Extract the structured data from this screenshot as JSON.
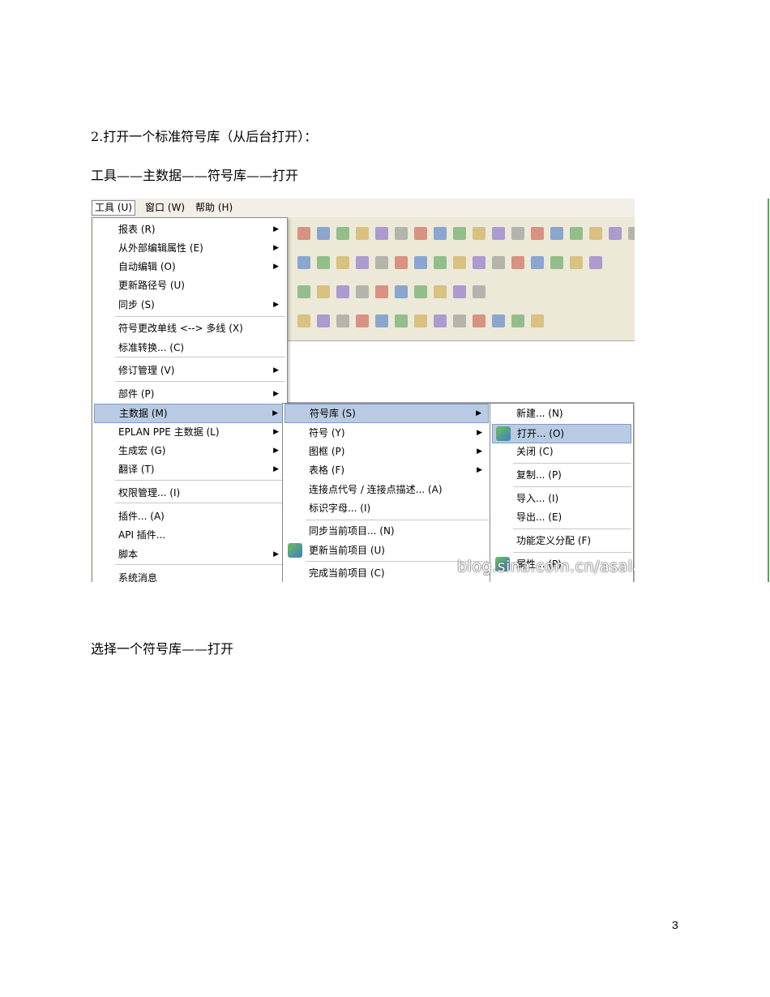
{
  "document": {
    "heading": "2.打开一个标准符号库（从后台打开）：",
    "path": "工具——主数据——符号库——打开",
    "caption": "选择一个符号库——打开",
    "page_number": "3"
  },
  "screenshot": {
    "menubar": [
      "工具 (U)",
      "窗口 (W)",
      "帮助 (H)"
    ],
    "tools_menu": [
      {
        "label": "报表 (R)",
        "submenu": true
      },
      {
        "label": "从外部编辑属性 (E)",
        "submenu": true
      },
      {
        "label": "自动编辑 (O)",
        "submenu": true
      },
      {
        "label": "更新路径号 (U)",
        "submenu": false
      },
      {
        "label": "同步 (S)",
        "submenu": true
      },
      {
        "label": "符号更改单线 <--> 多线 (X)",
        "submenu": false
      },
      {
        "label": "标准转换... (C)",
        "submenu": false
      },
      {
        "label": "修订管理 (V)",
        "submenu": true
      },
      {
        "label": "部件 (P)",
        "submenu": true
      },
      {
        "label": "主数据 (M)",
        "submenu": true
      },
      {
        "label": "EPLAN PPE 主数据 (L)",
        "submenu": true
      },
      {
        "label": "生成宏 (G)",
        "submenu": true
      },
      {
        "label": "翻译 (T)",
        "submenu": true
      },
      {
        "label": "权限管理... (I)",
        "submenu": false
      },
      {
        "label": "插件... (A)",
        "submenu": false
      },
      {
        "label": "API 插件...",
        "submenu": false
      },
      {
        "label": "脚本",
        "submenu": true
      },
      {
        "label": "系统消息",
        "submenu": false
      }
    ],
    "master_data_menu": [
      {
        "label": "符号库 (S)",
        "submenu": true
      },
      {
        "label": "符号 (Y)",
        "submenu": true
      },
      {
        "label": "图框 (P)",
        "submenu": true
      },
      {
        "label": "表格 (F)",
        "submenu": true
      },
      {
        "label": "连接点代号 / 连接点描述... (A)",
        "submenu": false
      },
      {
        "label": "标识字母... (I)",
        "submenu": false
      },
      {
        "label": "同步当前项目... (N)",
        "submenu": false
      },
      {
        "label": "更新当前项目 (U)",
        "submenu": false
      },
      {
        "label": "完成当前项目 (C)",
        "submenu": false
      }
    ],
    "symbol_library_menu": [
      "新建... (N)",
      "打开... (O)",
      "关闭 (C)",
      "复制... (P)",
      "导入... (I)",
      "导出... (E)",
      "功能定义分配 (F)",
      "属性... (P)"
    ],
    "watermark": "blog.sina.com.cn/asala"
  }
}
